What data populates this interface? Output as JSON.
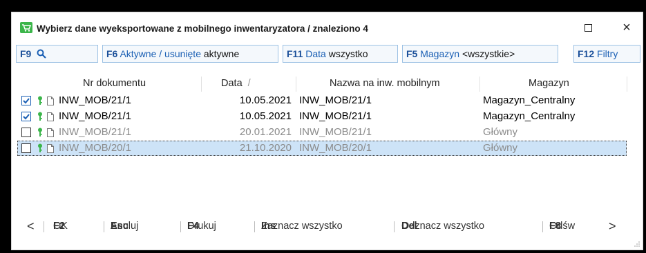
{
  "window": {
    "title": "Wybierz dane wyeksportowane z mobilnego inwentaryzatora / znaleziono 4",
    "close_glyph": "×"
  },
  "toolbar": {
    "search": {
      "key": "F9"
    },
    "aktywne": {
      "key": "F6",
      "label": "Aktywne / usunięte",
      "value": "aktywne"
    },
    "data": {
      "key": "F11",
      "label": "Data",
      "value": "wszystko"
    },
    "magazyn": {
      "key": "F5",
      "label": "Magazyn",
      "value": "<wszystkie>"
    },
    "filtry": {
      "key": "F12",
      "label": "Filtry"
    }
  },
  "grid": {
    "columns": [
      "Nr dokumentu",
      "Data",
      "Nazwa na inw. mobilnym",
      "Magazyn"
    ],
    "sort_indicator": "/",
    "rows": [
      {
        "checked": true,
        "doc": "INW_MOB/21/1",
        "date": "10.05.2021",
        "name": "INW_MOB/21/1",
        "magazyn": "Magazyn_Centralny",
        "dim": false,
        "selected": false
      },
      {
        "checked": true,
        "doc": "INW_MOB/21/1",
        "date": "10.05.2021",
        "name": "INW_MOB/21/1",
        "magazyn": "Magazyn_Centralny",
        "dim": false,
        "selected": false
      },
      {
        "checked": false,
        "doc": "INW_MOB/21/1",
        "date": "20.01.2021",
        "name": "INW_MOB/21/1",
        "magazyn": "Główny",
        "dim": true,
        "selected": false
      },
      {
        "checked": false,
        "doc": "INW_MOB/20/1",
        "date": "21.10.2020",
        "name": "INW_MOB/20/1",
        "magazyn": "Główny",
        "dim": true,
        "selected": true
      }
    ]
  },
  "footer": {
    "prev": "<",
    "next": ">",
    "ok": {
      "key": "F2",
      "label": "OK"
    },
    "anuluj": {
      "key": "Esc",
      "label": "Anuluj"
    },
    "drukuj": {
      "key": "F4",
      "label": "Drukuj"
    },
    "zaznacz": {
      "key": "Ins",
      "label": "Zaznacz wszystko"
    },
    "odznacz": {
      "key": "Del",
      "label": "Odznacz wszystko"
    },
    "odswiez": {
      "key": "F8",
      "label": "Odśw"
    }
  },
  "colors": {
    "accent": "#1a5fb4",
    "selection": "#cde3f7",
    "key_icon": "#3bb54a"
  }
}
